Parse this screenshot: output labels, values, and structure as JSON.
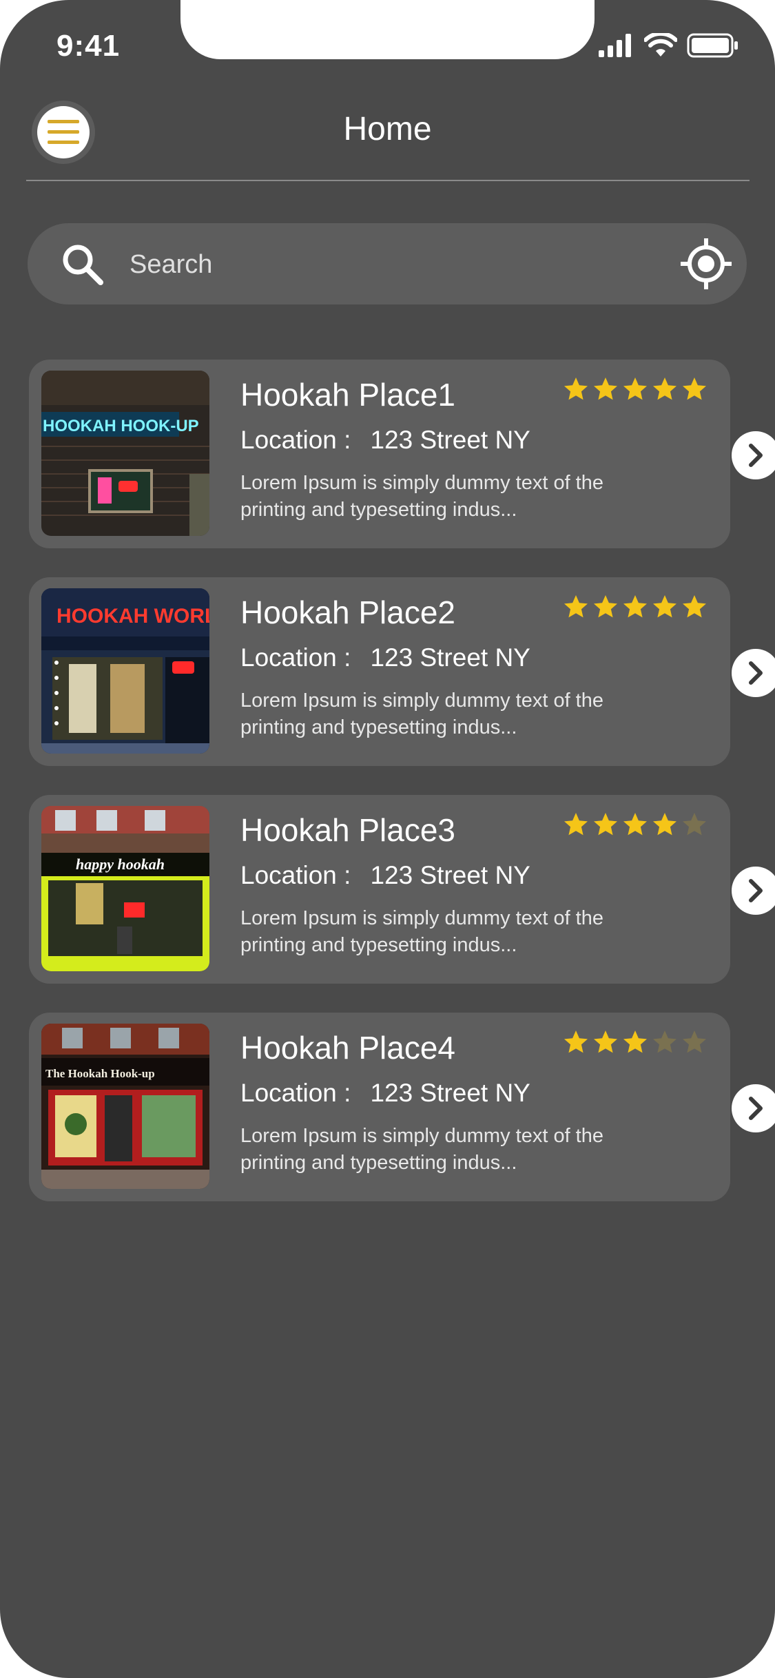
{
  "status_bar": {
    "time": "9:41"
  },
  "header": {
    "title": "Home"
  },
  "search": {
    "placeholder": "Search"
  },
  "colors": {
    "background": "#4a4a4a",
    "card": "#5e5e5e",
    "star": "#f5c518",
    "menu_lines": "#d6a82a"
  },
  "places": [
    {
      "name": "Hookah Place1",
      "location_label": "Location :",
      "location": "123 Street NY",
      "description": "Lorem Ipsum is simply dummy text of the printing and typesetting indus...",
      "rating": 5,
      "sign_text": "HOOKAH HOOK-UP"
    },
    {
      "name": "Hookah Place2",
      "location_label": "Location :",
      "location": "123 Street NY",
      "description": "Lorem Ipsum is simply dummy text of the printing and typesetting indus...",
      "rating": 5,
      "sign_text": "HOOKAH WORLD"
    },
    {
      "name": "Hookah Place3",
      "location_label": "Location :",
      "location": "123 Street NY",
      "description": "Lorem Ipsum is simply dummy text of the printing and typesetting indus...",
      "rating": 4,
      "sign_text": "happy hookah"
    },
    {
      "name": "Hookah Place4",
      "location_label": "Location :",
      "location": "123 Street NY",
      "description": "Lorem Ipsum is simply dummy text of the printing and typesetting indus...",
      "rating": 3,
      "sign_text": "The Hookah Hook-up"
    }
  ]
}
